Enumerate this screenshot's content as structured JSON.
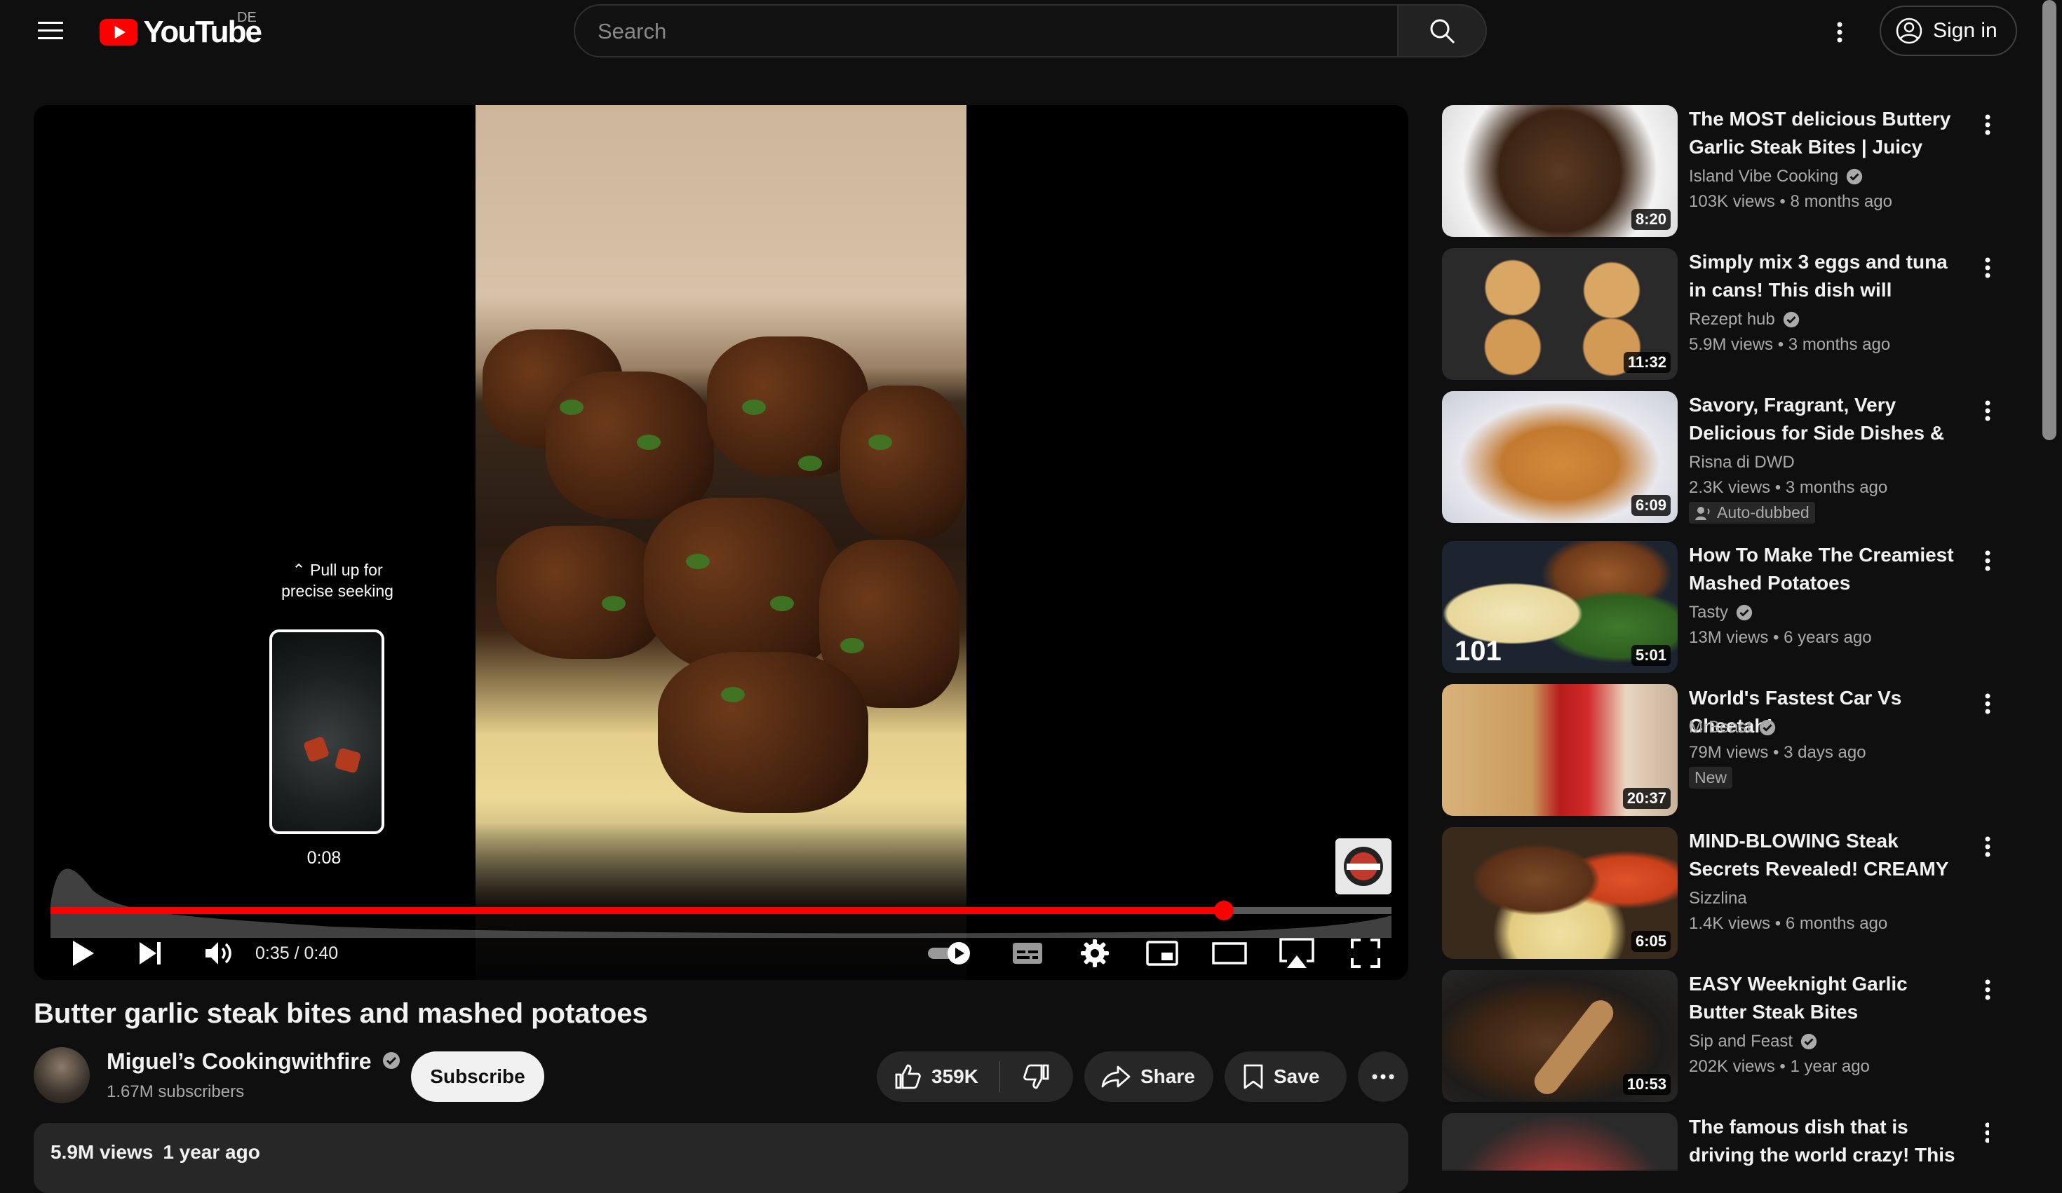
{
  "header": {
    "logo_text": "YouTube",
    "country_code": "DE",
    "search_placeholder": "Search",
    "signin_label": "Sign in"
  },
  "player": {
    "current_time": "0:35",
    "duration": "0:40",
    "time_display": "0:35 / 0:40",
    "progress_fraction": 0.875,
    "seek_hint": "Pull up for precise seeking",
    "seek_preview_time": "0:08",
    "accent_color": "#ff0000"
  },
  "video": {
    "title": "Butter garlic steak bites and mashed potatoes",
    "channel": "Miguel’s Cookingwithfire",
    "subscribers": "1.67M subscribers",
    "subscribe_label": "Subscribe",
    "likes": "359K",
    "share_label": "Share",
    "save_label": "Save",
    "views": "5.9M views",
    "age": "1 year ago"
  },
  "recommendations": [
    {
      "title": "The MOST delicious Buttery Garlic Steak Bites | Juicy Stea…",
      "channel": "Island Vibe Cooking",
      "verified": true,
      "views": "103K views",
      "age": "8 months ago",
      "duration": "8:20",
      "badge": ""
    },
    {
      "title": "Simply mix 3 eggs and tuna in cans! This dish will impress…",
      "channel": "Rezept hub",
      "verified": true,
      "views": "5.9M views",
      "age": "3 months ago",
      "duration": "11:32",
      "badge": ""
    },
    {
      "title": "Savory, Fragrant, Very Delicious for Side Dishes & Snacks‼️…",
      "channel": "Risna di DWD",
      "verified": false,
      "views": "2.3K views",
      "age": "3 months ago",
      "duration": "6:09",
      "badge": "Auto-dubbed"
    },
    {
      "title": "How To Make The Creamiest Mashed Potatoes",
      "channel": "Tasty",
      "verified": true,
      "views": "13M views",
      "age": "6 years ago",
      "duration": "5:01",
      "badge": ""
    },
    {
      "title": "World's Fastest Car Vs Cheetah!",
      "channel": "MrBeast",
      "verified": true,
      "views": "79M views",
      "age": "3 days ago",
      "duration": "20:37",
      "badge": "New"
    },
    {
      "title": "MIND-BLOWING Steak Secrets Revealed! CREAMY Mashed…",
      "channel": "Sizzlina",
      "verified": false,
      "views": "1.4K views",
      "age": "6 months ago",
      "duration": "6:05",
      "badge": ""
    },
    {
      "title": "EASY Weeknight Garlic Butter Steak Bites",
      "channel": "Sip and Feast",
      "verified": true,
      "views": "202K views",
      "age": "1 year ago",
      "duration": "10:53",
      "badge": ""
    },
    {
      "title": "The famous dish that is driving the world crazy! This is the…",
      "channel": "",
      "verified": false,
      "views": "",
      "age": "",
      "duration": "",
      "badge": ""
    }
  ],
  "thumb_101_label": "101"
}
